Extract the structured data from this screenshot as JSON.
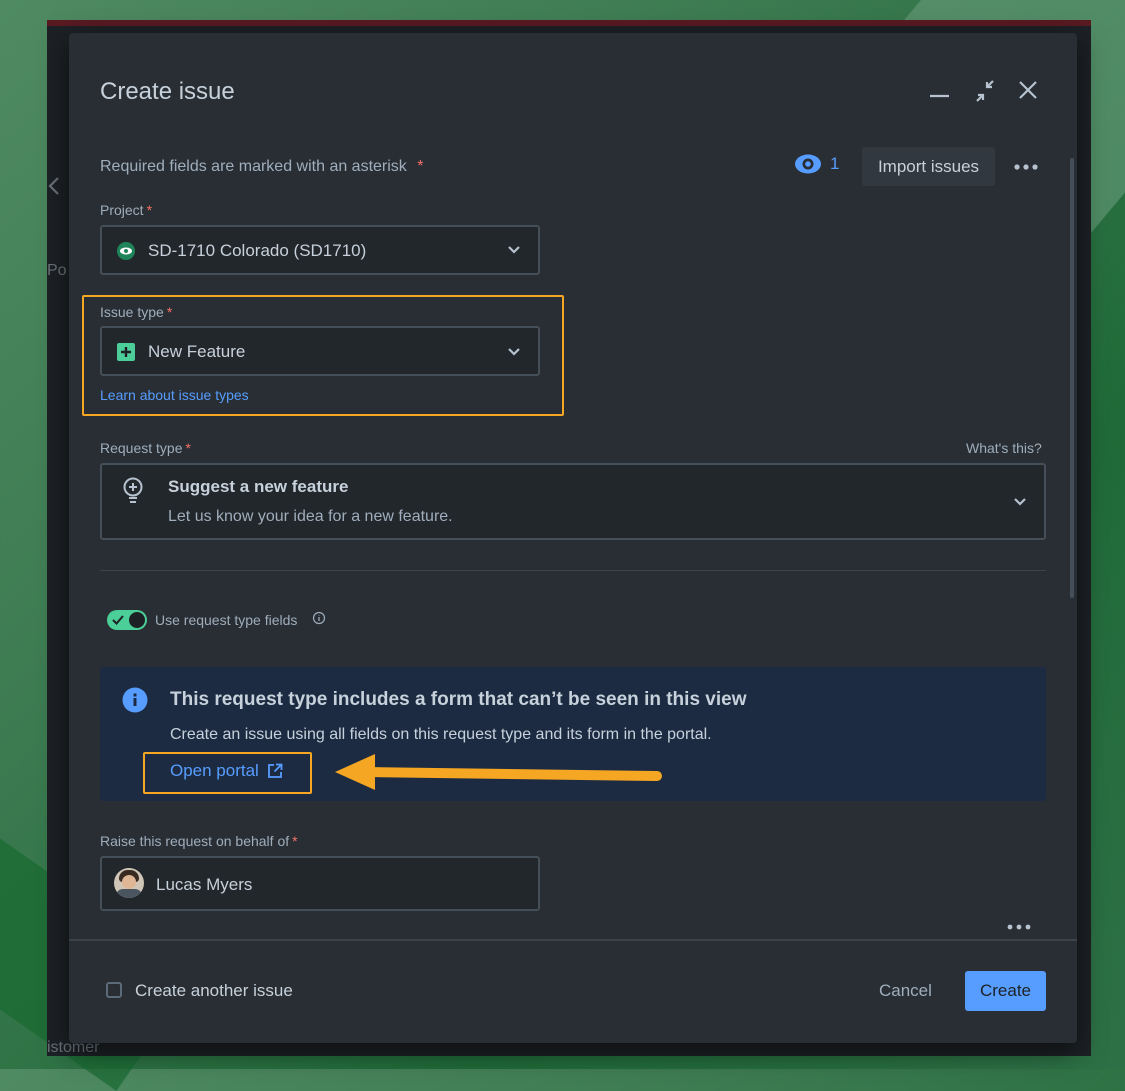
{
  "background": {
    "left_label_1": "Po",
    "bottom_label": "istomer"
  },
  "dialog": {
    "title": "Create issue",
    "required_notice": "Required fields are marked with an asterisk",
    "asterisk": "*",
    "watch_count": "1",
    "import_label": "Import issues",
    "project": {
      "label": "Project",
      "value": "SD-1710 Colorado (SD1710)"
    },
    "issue_type": {
      "label": "Issue type",
      "value": "New Feature",
      "learn_link": "Learn about issue types"
    },
    "request_type": {
      "label": "Request type",
      "whats_this": "What's this?",
      "title": "Suggest a new feature",
      "description": "Let us know your idea for a new feature."
    },
    "toggle": {
      "label": "Use request type fields",
      "on": true
    },
    "info": {
      "title": "This request type includes a form that can’t be seen in this view",
      "body": "Create an issue using all fields on this request type and its form in the portal.",
      "open_portal": "Open portal"
    },
    "behalf": {
      "label": "Raise this request on behalf of",
      "value": "Lucas Myers"
    },
    "footer": {
      "create_another": "Create another issue",
      "cancel": "Cancel",
      "create": "Create"
    }
  },
  "colors": {
    "modal_bg": "#282e33",
    "accent": "#579dff",
    "annotation": "#f5a623",
    "toggle_on": "#4bce97",
    "required": "#f87168",
    "info_bg": "#1c2b41"
  },
  "icons": {
    "minimize": "minimize-icon",
    "collapse": "collapse-icon",
    "close": "close-icon",
    "watch": "eye-icon",
    "more": "more-icon",
    "project": "project-avatar-icon",
    "issue_type": "new-feature-icon",
    "request_type": "lightbulb-icon",
    "info": "info-icon",
    "external": "external-link-icon"
  }
}
